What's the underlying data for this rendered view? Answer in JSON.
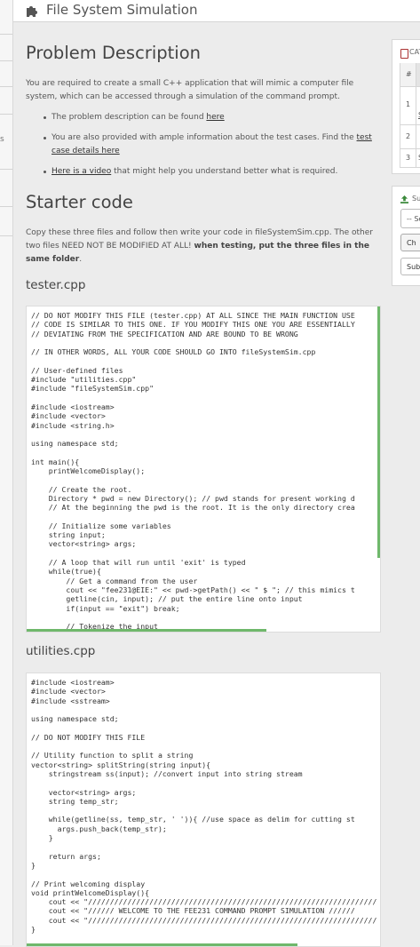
{
  "header": {
    "title": "File System Simulation",
    "icon": "puzzle-icon"
  },
  "problem": {
    "heading": "Problem Description",
    "intro": "You are required to create a small C++ application that will mimic a computer file system, which can be accessed through a simulation of the command prompt.",
    "bullet1_text": "The problem description can be found ",
    "bullet1_link": "here",
    "bullet2_text": "You are also provided with ample information about the test cases. Find the ",
    "bullet2_link": "test case details here",
    "bullet3_link": "Here is a video",
    "bullet3_text": " that might help you understand better what is required."
  },
  "starter": {
    "heading": "Starter code",
    "intro": "Copy these three files and follow then write your code in fileSystemSim.cpp. The other two files NEED NOT BE MODIFIED AT ALL! ",
    "intro_bold": "when testing, put the three files in the same folder",
    "intro_end": "."
  },
  "files": [
    {
      "name": "tester.cpp",
      "code": "// DO NOT MODIFY THIS FILE (tester.cpp) AT ALL SINCE THE MAIN FUNCTION USE\n// CODE IS SIMILAR TO THIS ONE. IF YOU MODIFY THIS ONE YOU ARE ESSENTIALLY\n// DEVIATING FROM THE SPECIFICATION AND ARE BOUND TO BE WRONG\n\n// IN OTHER WORDS, ALL YOUR CODE SHOULD GO INTO fileSystemSim.cpp\n\n// User-defined files\n#include \"utilities.cpp\"\n#include \"fileSystemSim.cpp\"\n\n#include <iostream>\n#include <vector>\n#include <string.h>\n\nusing namespace std;\n\nint main(){\n    printWelcomeDisplay();\n\n    // Create the root.\n    Directory * pwd = new Directory(); // pwd stands for present working d\n    // At the beginning the pwd is the root. It is the only directory crea\n\n    // Initialize some variables\n    string input;\n    vector<string> args;\n\n    // A loop that will run until 'exit' is typed\n    while(true){\n        // Get a command from the user\n        cout << \"fee231@EIE:\" << pwd->getPath() << \" $ \"; // this mimics t\n        getline(cin, input); // put the entire line onto input\n        if(input == \"exit\") break;\n\n        // Tokenize the input"
    },
    {
      "name": "utilities.cpp",
      "code": "#include <iostream>\n#include <vector>\n#include <sstream>\n\nusing namespace std;\n\n// DO NOT MODIFY THIS FILE\n\n// Utility function to split a string\nvector<string> splitString(string input){\n    stringstream ss(input); //convert input into string stream\n\n    vector<string> args;\n    string temp_str;\n\n    while(getline(ss, temp_str, ' ')){ //use space as delim for cutting st\n      args.push_back(temp_str);\n    }\n\n    return args;\n}\n\n// Print welcoming display\nvoid printWelcomeDisplay(){\n    cout << \"//////////////////////////////////////////////////////////////////\n    cout << \"////// WELCOME TO THE FEE231 COMMAND PROMPT SIMULATION //////\n    cout << \"//////////////////////////////////////////////////////////////////\n}"
    }
  ],
  "side": {
    "panel1_label": "CAT",
    "panel1_hash": "#",
    "rows": [
      {
        "n": "1",
        "c": "S"
      },
      {
        "n": "2",
        "c": ""
      },
      {
        "n": "3",
        "c": "S"
      }
    ],
    "panel2_label": "Su",
    "select_value": "-- Se",
    "btn1": "Ch",
    "btn2": "Sub"
  },
  "colors": {
    "accent_green": "#6fb86b",
    "background": "#ececec"
  }
}
